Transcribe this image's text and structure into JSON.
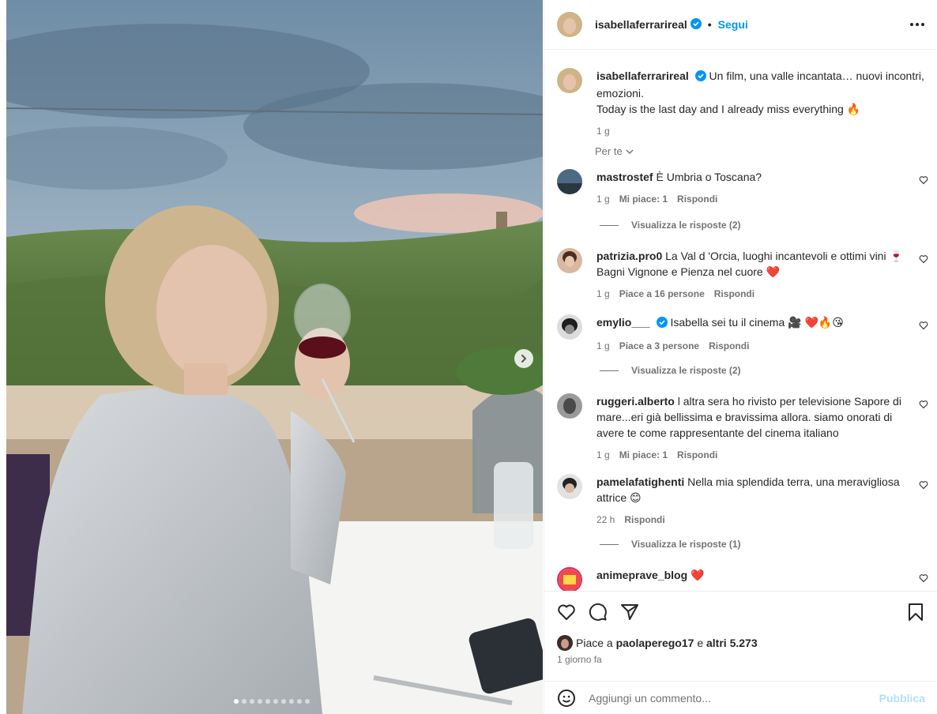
{
  "post": {
    "username": "isabellaferrarireal",
    "follow_label": "Segui",
    "separator": "•",
    "caption_line1": "Un film, una valle incantata… nuovi incontri, emozioni.",
    "caption_line2": "Today is the last day and I already miss everything 🔥",
    "caption_time": "1 g",
    "filter_label": "Per te",
    "media_slides_total": 10,
    "media_slide_current": 1
  },
  "comments": [
    {
      "user": "mastrostef",
      "text": "È Umbria o Toscana?",
      "time": "1 g",
      "likes": "Mi piace: 1",
      "reply": "Rispondi",
      "view_replies": "Visualizza le risposte (2)"
    },
    {
      "user": "patrizia.pro0",
      "text": "La Val d 'Orcia, luoghi incantevoli e ottimi vini 🍷 Bagni Vignone e Pienza nel cuore ❤️",
      "time": "1 g",
      "likes": "Piace a 16 persone",
      "reply": "Rispondi"
    },
    {
      "user": "emylio___",
      "text": "Isabella sei tu il cinema 🎥 ❤️🔥😘",
      "time": "1 g",
      "likes": "Piace a 3 persone",
      "reply": "Rispondi",
      "view_replies": "Visualizza le risposte (2)"
    },
    {
      "user": "ruggeri.alberto",
      "text": "l altra sera ho rivisto per televisione Sapore di mare...eri già bellissima e bravissima allora. siamo onorati di avere te come rappresentante del cinema italiano",
      "time": "1 g",
      "likes": "Mi piace: 1",
      "reply": "Rispondi"
    },
    {
      "user": "pamelafatighenti",
      "text": "Nella mia splendida terra, una meravigliosa attrice 😊",
      "time": "22 h",
      "reply": "Rispondi",
      "view_replies": "Visualizza le risposte (1)"
    },
    {
      "user": "animeprave_blog",
      "text": "❤️"
    }
  ],
  "likes": {
    "prefix": "Piace a",
    "user": "paolaperego17",
    "joiner": "e",
    "others": "altri 5.273",
    "time": "1 giorno fa"
  },
  "add_comment": {
    "placeholder": "Aggiungi un commento...",
    "publish_label": "Pubblica"
  },
  "icons": {
    "verified": "verified-badge-icon",
    "more": "more-options-icon",
    "like": "heart-icon",
    "comment": "comment-bubble-icon",
    "share": "paper-plane-icon",
    "save": "bookmark-icon",
    "emoji": "emoji-smiley-icon",
    "next": "chevron-right-icon"
  },
  "colors": {
    "link": "#0095f6",
    "publish_disabled": "#b2dffc",
    "muted": "#737373",
    "text": "#262626"
  }
}
